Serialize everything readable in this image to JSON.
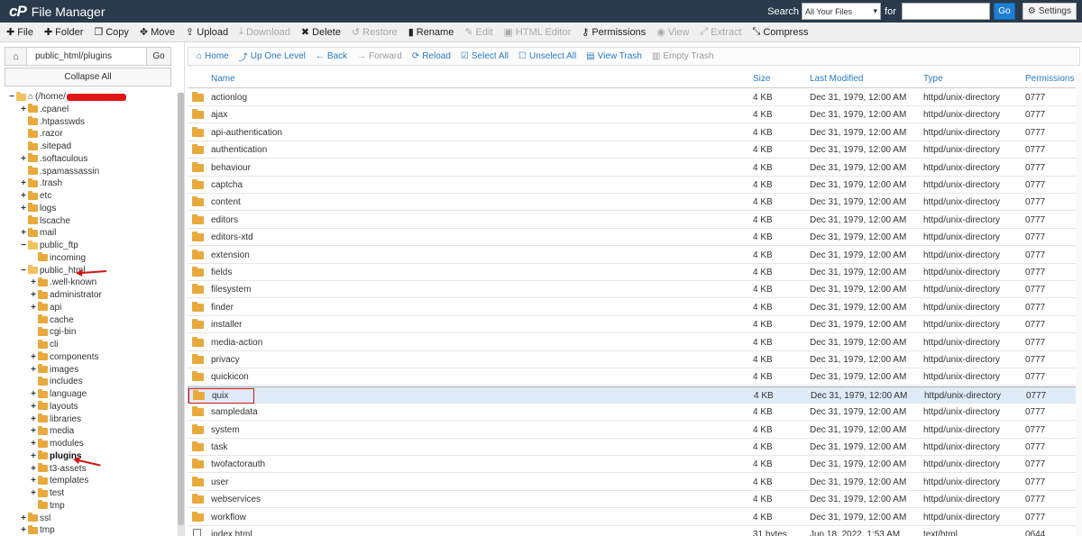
{
  "header": {
    "app_title": "File Manager",
    "search_label": "Search",
    "search_scope": "All Your Files",
    "for_label": "for",
    "go_label": "Go",
    "settings_label": "Settings",
    "logo_icon": "cpanel-logo-icon"
  },
  "toolbar": {
    "file": "File",
    "folder": "Folder",
    "copy": "Copy",
    "move": "Move",
    "upload": "Upload",
    "download": "Download",
    "delete": "Delete",
    "restore": "Restore",
    "rename": "Rename",
    "edit": "Edit",
    "html_editor": "HTML Editor",
    "permissions": "Permissions",
    "view": "View",
    "extract": "Extract",
    "compress": "Compress"
  },
  "left": {
    "path_value": "public_html/plugins",
    "go_label": "Go",
    "collapse_all": "Collapse All",
    "tree": [
      {
        "label": "(/home/",
        "toggle": "−",
        "depth": 0,
        "icon": "folder-open-icon",
        "home": true
      },
      {
        "label": ".cpanel",
        "toggle": "+",
        "depth": 1
      },
      {
        "label": ".htpasswds",
        "toggle": "",
        "depth": 1
      },
      {
        "label": ".razor",
        "toggle": "",
        "depth": 1
      },
      {
        "label": ".sitepad",
        "toggle": "",
        "depth": 1
      },
      {
        "label": ".softaculous",
        "toggle": "+",
        "depth": 1
      },
      {
        "label": ".spamassassin",
        "toggle": "",
        "depth": 1
      },
      {
        "label": ".trash",
        "toggle": "+",
        "depth": 1
      },
      {
        "label": "etc",
        "toggle": "+",
        "depth": 1
      },
      {
        "label": "logs",
        "toggle": "+",
        "depth": 1
      },
      {
        "label": "lscache",
        "toggle": "",
        "depth": 1
      },
      {
        "label": "mail",
        "toggle": "+",
        "depth": 1
      },
      {
        "label": "public_ftp",
        "toggle": "−",
        "depth": 1
      },
      {
        "label": "incoming",
        "toggle": "",
        "depth": 2
      },
      {
        "label": "public_html",
        "toggle": "−",
        "depth": 1
      },
      {
        "label": ".well-known",
        "toggle": "+",
        "depth": 2
      },
      {
        "label": "administrator",
        "toggle": "+",
        "depth": 2
      },
      {
        "label": "api",
        "toggle": "+",
        "depth": 2
      },
      {
        "label": "cache",
        "toggle": "",
        "depth": 2
      },
      {
        "label": "cgi-bin",
        "toggle": "",
        "depth": 2
      },
      {
        "label": "cli",
        "toggle": "",
        "depth": 2
      },
      {
        "label": "components",
        "toggle": "+",
        "depth": 2
      },
      {
        "label": "images",
        "toggle": "+",
        "depth": 2
      },
      {
        "label": "includes",
        "toggle": "",
        "depth": 2
      },
      {
        "label": "language",
        "toggle": "+",
        "depth": 2
      },
      {
        "label": "layouts",
        "toggle": "+",
        "depth": 2
      },
      {
        "label": "libraries",
        "toggle": "+",
        "depth": 2
      },
      {
        "label": "media",
        "toggle": "+",
        "depth": 2
      },
      {
        "label": "modules",
        "toggle": "+",
        "depth": 2
      },
      {
        "label": "plugins",
        "toggle": "+",
        "depth": 2,
        "bold": true
      },
      {
        "label": "t3-assets",
        "toggle": "+",
        "depth": 2
      },
      {
        "label": "templates",
        "toggle": "+",
        "depth": 2
      },
      {
        "label": "test",
        "toggle": "+",
        "depth": 2
      },
      {
        "label": "tmp",
        "toggle": "",
        "depth": 2
      },
      {
        "label": "ssl",
        "toggle": "+",
        "depth": 1
      },
      {
        "label": "tmp",
        "toggle": "+",
        "depth": 1
      }
    ]
  },
  "nav": {
    "home": "Home",
    "up_one_level": "Up One Level",
    "back": "Back",
    "forward": "Forward",
    "reload": "Reload",
    "select_all": "Select All",
    "unselect_all": "Unselect All",
    "view_trash": "View Trash",
    "empty_trash": "Empty Trash"
  },
  "table": {
    "columns": [
      "Name",
      "Size",
      "Last Modified",
      "Type",
      "Permissions"
    ],
    "rows": [
      {
        "name": "actionlog",
        "size": "4 KB",
        "modified": "Dec 31, 1979, 12:00 AM",
        "type": "httpd/unix-directory",
        "perms": "0777"
      },
      {
        "name": "ajax",
        "size": "4 KB",
        "modified": "Dec 31, 1979, 12:00 AM",
        "type": "httpd/unix-directory",
        "perms": "0777"
      },
      {
        "name": "api-authentication",
        "size": "4 KB",
        "modified": "Dec 31, 1979, 12:00 AM",
        "type": "httpd/unix-directory",
        "perms": "0777"
      },
      {
        "name": "authentication",
        "size": "4 KB",
        "modified": "Dec 31, 1979, 12:00 AM",
        "type": "httpd/unix-directory",
        "perms": "0777"
      },
      {
        "name": "behaviour",
        "size": "4 KB",
        "modified": "Dec 31, 1979, 12:00 AM",
        "type": "httpd/unix-directory",
        "perms": "0777"
      },
      {
        "name": "captcha",
        "size": "4 KB",
        "modified": "Dec 31, 1979, 12:00 AM",
        "type": "httpd/unix-directory",
        "perms": "0777"
      },
      {
        "name": "content",
        "size": "4 KB",
        "modified": "Dec 31, 1979, 12:00 AM",
        "type": "httpd/unix-directory",
        "perms": "0777"
      },
      {
        "name": "editors",
        "size": "4 KB",
        "modified": "Dec 31, 1979, 12:00 AM",
        "type": "httpd/unix-directory",
        "perms": "0777"
      },
      {
        "name": "editors-xtd",
        "size": "4 KB",
        "modified": "Dec 31, 1979, 12:00 AM",
        "type": "httpd/unix-directory",
        "perms": "0777"
      },
      {
        "name": "extension",
        "size": "4 KB",
        "modified": "Dec 31, 1979, 12:00 AM",
        "type": "httpd/unix-directory",
        "perms": "0777"
      },
      {
        "name": "fields",
        "size": "4 KB",
        "modified": "Dec 31, 1979, 12:00 AM",
        "type": "httpd/unix-directory",
        "perms": "0777"
      },
      {
        "name": "filesystem",
        "size": "4 KB",
        "modified": "Dec 31, 1979, 12:00 AM",
        "type": "httpd/unix-directory",
        "perms": "0777"
      },
      {
        "name": "finder",
        "size": "4 KB",
        "modified": "Dec 31, 1979, 12:00 AM",
        "type": "httpd/unix-directory",
        "perms": "0777"
      },
      {
        "name": "installer",
        "size": "4 KB",
        "modified": "Dec 31, 1979, 12:00 AM",
        "type": "httpd/unix-directory",
        "perms": "0777"
      },
      {
        "name": "media-action",
        "size": "4 KB",
        "modified": "Dec 31, 1979, 12:00 AM",
        "type": "httpd/unix-directory",
        "perms": "0777"
      },
      {
        "name": "privacy",
        "size": "4 KB",
        "modified": "Dec 31, 1979, 12:00 AM",
        "type": "httpd/unix-directory",
        "perms": "0777"
      },
      {
        "name": "quickicon",
        "size": "4 KB",
        "modified": "Dec 31, 1979, 12:00 AM",
        "type": "httpd/unix-directory",
        "perms": "0777"
      },
      {
        "name": "quix",
        "size": "4 KB",
        "modified": "Dec 31, 1979, 12:00 AM",
        "type": "httpd/unix-directory",
        "perms": "0777",
        "selected": true
      },
      {
        "name": "sampledata",
        "size": "4 KB",
        "modified": "Dec 31, 1979, 12:00 AM",
        "type": "httpd/unix-directory",
        "perms": "0777"
      },
      {
        "name": "system",
        "size": "4 KB",
        "modified": "Dec 31, 1979, 12:00 AM",
        "type": "httpd/unix-directory",
        "perms": "0777"
      },
      {
        "name": "task",
        "size": "4 KB",
        "modified": "Dec 31, 1979, 12:00 AM",
        "type": "httpd/unix-directory",
        "perms": "0777"
      },
      {
        "name": "twofactorauth",
        "size": "4 KB",
        "modified": "Dec 31, 1979, 12:00 AM",
        "type": "httpd/unix-directory",
        "perms": "0777"
      },
      {
        "name": "user",
        "size": "4 KB",
        "modified": "Dec 31, 1979, 12:00 AM",
        "type": "httpd/unix-directory",
        "perms": "0777"
      },
      {
        "name": "webservices",
        "size": "4 KB",
        "modified": "Dec 31, 1979, 12:00 AM",
        "type": "httpd/unix-directory",
        "perms": "0777"
      },
      {
        "name": "workflow",
        "size": "4 KB",
        "modified": "Dec 31, 1979, 12:00 AM",
        "type": "httpd/unix-directory",
        "perms": "0777"
      },
      {
        "name": "index.html",
        "size": "31 bytes",
        "modified": "Jun 18, 2022, 1:53 AM",
        "type": "text/html",
        "perms": "0644",
        "file": true
      }
    ]
  },
  "colors": {
    "header_bg": "#293a4a",
    "link_blue": "#2a7bc0",
    "folder_orange": "#e8a93d",
    "selected_row": "#dcebf7",
    "annotation_red": "#d41515"
  }
}
